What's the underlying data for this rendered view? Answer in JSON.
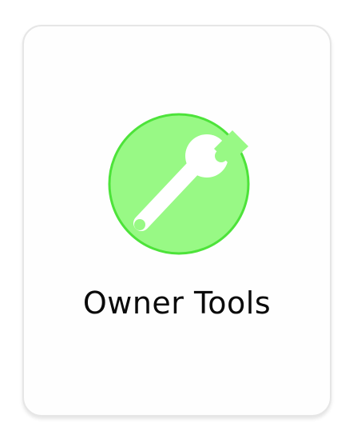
{
  "tile": {
    "label": "Owner Tools",
    "icon": "wrench-icon",
    "icon_bg_color": "#98f985",
    "icon_border_color": "#4de33a"
  }
}
